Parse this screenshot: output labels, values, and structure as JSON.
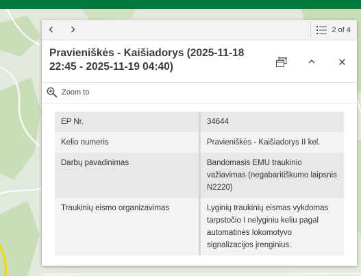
{
  "colors": {
    "brand_bar": "#007a3d",
    "map_land": "#e3e8dd",
    "map_forest": "#c9ddb8",
    "popup_bg": "#ffffff",
    "row_alt": "#e8e8e8"
  },
  "popup": {
    "pager": {
      "text": "2 of 4",
      "icon": "list-icon"
    },
    "nav": {
      "prev_icon": "chevron-left-icon",
      "next_icon": "chevron-right-icon"
    },
    "title": "Pravieniškės - Kaišiadorys (2025-11-18 22:45 - 2025-11-19 04:40)",
    "header_actions": {
      "dock_icon": "dock-icon",
      "collapse_icon": "chevron-up-icon",
      "close_icon": "close-icon"
    },
    "zoom_to": {
      "label": "Zoom to",
      "icon": "zoom-in-icon"
    },
    "attributes": [
      {
        "key": "EP Nr.",
        "value": "34644"
      },
      {
        "key": "Kelio numeris",
        "value": "Pravieniškės - Kaišiadorys II kel."
      },
      {
        "key": "Darbų pavadinimas",
        "value": "Bandomasis EMU traukinio važiavimas (negabaritiškumo laipsnis N2220)"
      },
      {
        "key": "Traukinių eismo organizavimas",
        "value": "Lyginių traukinių eismas vykdomas tarpstočio I nelyginiu keliu pagal automatinės lokomotyvo signalizacijos įrenginius."
      }
    ]
  }
}
